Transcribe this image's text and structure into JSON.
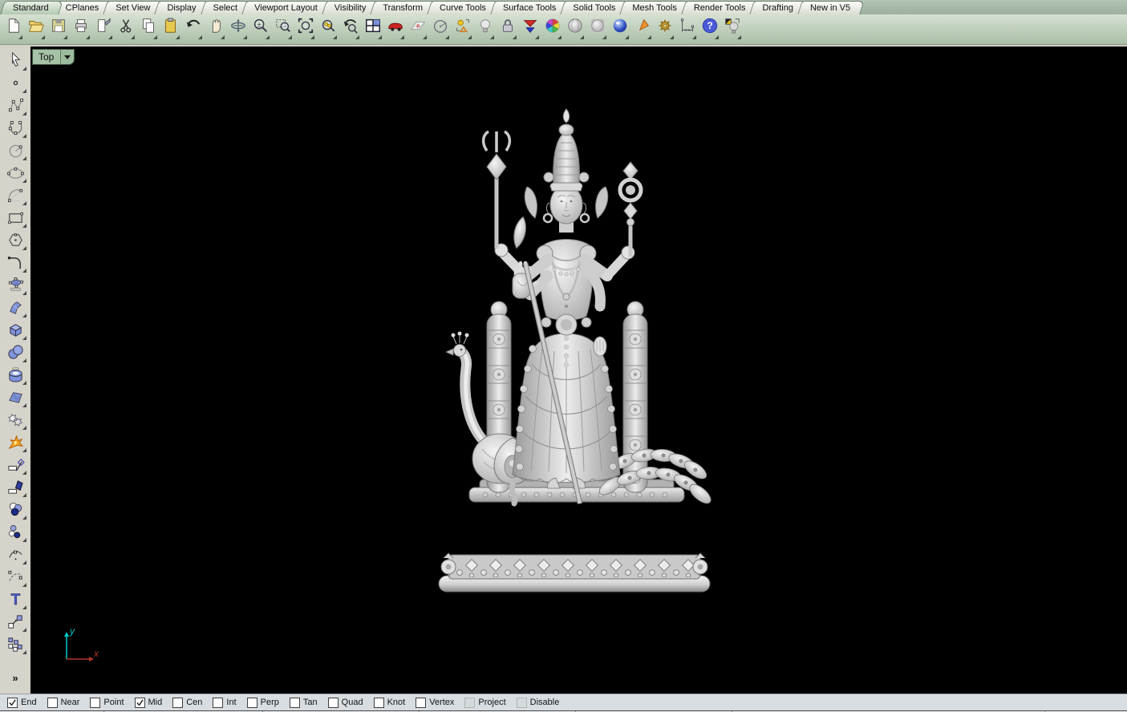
{
  "menu_tabs": {
    "items": [
      {
        "label": "Standard",
        "active": true
      },
      {
        "label": "CPlanes",
        "active": false
      },
      {
        "label": "Set View",
        "active": false
      },
      {
        "label": "Display",
        "active": false
      },
      {
        "label": "Select",
        "active": false
      },
      {
        "label": "Viewport Layout",
        "active": false
      },
      {
        "label": "Visibility",
        "active": false
      },
      {
        "label": "Transform",
        "active": false
      },
      {
        "label": "Curve Tools",
        "active": false
      },
      {
        "label": "Surface Tools",
        "active": false
      },
      {
        "label": "Solid Tools",
        "active": false
      },
      {
        "label": "Mesh Tools",
        "active": false
      },
      {
        "label": "Render Tools",
        "active": false
      },
      {
        "label": "Drafting",
        "active": false
      },
      {
        "label": "New in V5",
        "active": false
      }
    ]
  },
  "toolbar": {
    "icons": [
      "new-document-icon",
      "open-file-icon",
      "save-file-icon",
      "print-icon",
      "spray-edit-icon",
      "cut-icon",
      "copy-icon",
      "paste-icon",
      "undo-icon",
      "pan-hand-icon",
      "rotate-view-icon",
      "zoom-dynamic-icon",
      "zoom-window-icon",
      "zoom-extents-icon",
      "zoom-selected-icon",
      "undo-view-icon",
      "viewport-layout-icon",
      "car-icon",
      "cplane-icon",
      "circle-center-icon",
      "snap-shapes-icon",
      "light-bulb-icon",
      "lock-icon",
      "layer-wedge-icon",
      "color-wheel-icon",
      "shaded-sphere-icon",
      "ghosted-sphere-icon",
      "rendered-sphere-icon",
      "spotlight-cone-icon",
      "gears-icon",
      "dimension-icon",
      "help-icon",
      "lamp-icon"
    ]
  },
  "left_toolbar": {
    "icons": [
      "pointer-icon",
      "point-icon",
      "control-point-curve-icon",
      "interpolate-curve-icon",
      "circle-icon",
      "ellipse-icon",
      "arc-icon",
      "rectangle-icon",
      "polygon-icon",
      "fillet-corner-icon",
      "surface-control-points-icon",
      "curved-surface-icon",
      "box-icon",
      "sphere-icon",
      "cylinder-icon",
      "patch-surface-icon",
      "boolean-icon",
      "explode-icon",
      "trim-icon",
      "split-icon",
      "join-icon",
      "group-icon",
      "edit-point-icon",
      "rebuild-curve-icon",
      "text-icon",
      "move-icon",
      "array-icon"
    ],
    "expand_label": "»"
  },
  "viewport": {
    "title": "Top",
    "background": "#000000"
  },
  "axis_indicator": {
    "x_label": "x",
    "y_label": "y",
    "x_color": "#b23325",
    "y_color": "#00c8c8"
  },
  "osnap_bar": {
    "items": [
      {
        "label": "End",
        "checked": true,
        "disabled": false
      },
      {
        "label": "Near",
        "checked": false,
        "disabled": false
      },
      {
        "label": "Point",
        "checked": false,
        "disabled": false
      },
      {
        "label": "Mid",
        "checked": true,
        "disabled": false
      },
      {
        "label": "Cen",
        "checked": false,
        "disabled": false
      },
      {
        "label": "Int",
        "checked": false,
        "disabled": false
      },
      {
        "label": "Perp",
        "checked": false,
        "disabled": false
      },
      {
        "label": "Tan",
        "checked": false,
        "disabled": false
      },
      {
        "label": "Quad",
        "checked": false,
        "disabled": false
      },
      {
        "label": "Knot",
        "checked": false,
        "disabled": false
      },
      {
        "label": "Vertex",
        "checked": false,
        "disabled": false
      },
      {
        "label": "Project",
        "checked": false,
        "disabled": true
      },
      {
        "label": "Disable",
        "checked": false,
        "disabled": true
      }
    ]
  },
  "colors": {
    "toolbar_tint": "#b7c9b3",
    "viewport_tab_green": "#a6c2a6",
    "statusbar_background": "#d7dde1"
  }
}
